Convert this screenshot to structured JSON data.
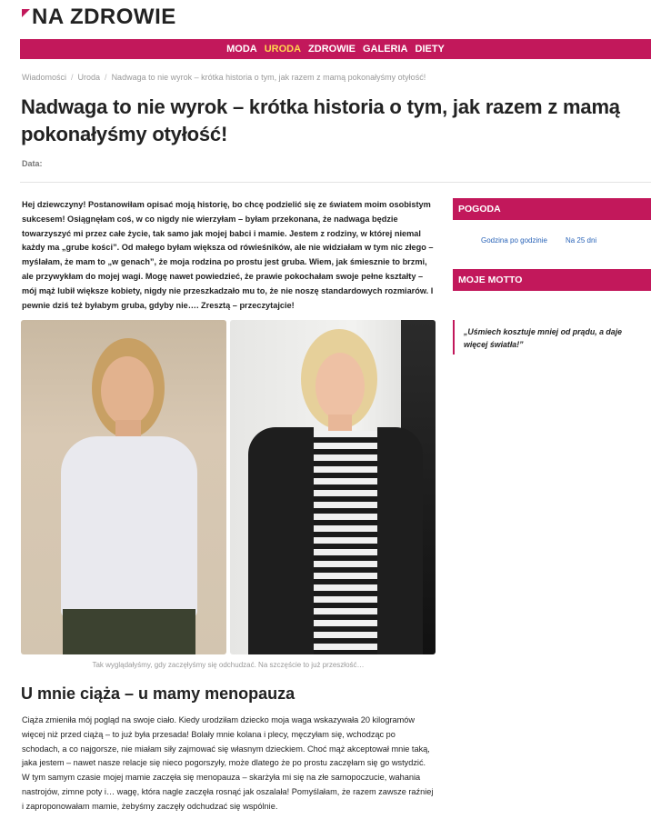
{
  "logo": {
    "text": "NA ZDROWIE"
  },
  "nav": {
    "items": [
      {
        "label": "MODA",
        "active": false
      },
      {
        "label": "URODA",
        "active": true
      },
      {
        "label": "ZDROWIE",
        "active": false
      },
      {
        "label": "GALERIA",
        "active": false
      },
      {
        "label": "DIETY",
        "active": false
      }
    ]
  },
  "breadcrumb": {
    "items": [
      "Wiadomości",
      "Uroda",
      "Nadwaga to nie wyrok – krótka historia o tym, jak razem z mamą pokonałyśmy otyłość!"
    ],
    "separator": "/"
  },
  "article": {
    "title": "Nadwaga to nie wyrok – krótka historia o tym, jak razem z mamą pokonałyśmy otyłość!",
    "date_label": "Data:",
    "intro": "Hej dziewczyny! Postanowiłam opisać moją historię, bo chcę podzielić się ze światem moim osobistym sukcesem! Osiągnęłam coś, w co nigdy nie wierzyłam – byłam przekonana, że nadwaga będzie towarzyszyć mi przez całe życie, tak samo jak mojej babci i mamie. Jestem z rodziny, w której niemal każdy ma „grube kości”. Od małego byłam większa od rówieśników, ale nie widziałam w tym nic złego – myślałam, że mam to „w genach”, że moja rodzina po prostu jest gruba. Wiem, jak śmiesznie to brzmi, ale przywykłam do mojej wagi. Mogę nawet powiedzieć, że prawie pokochałam swoje pełne kształty – mój mąż lubił większe kobiety, nigdy nie przeszkadzało mu to, że nie noszę standardowych rozmiarów. I pewnie dziś też byłabym gruba, gdyby nie…. Zresztą – przeczytajcie!",
    "photo_caption": "Tak wyglądałyśmy, gdy zaczęłyśmy się odchudzać. Na szczęście to już przeszłość…",
    "section_heading": "U mnie ciąża – u mamy menopauza",
    "paragraph1": "Ciąża zmieniła mój pogląd na swoje ciało. Kiedy urodziłam dziecko moja waga wskazywała 20 kilogramów więcej niż przed ciążą – to już była przesada! Bolały mnie kolana i plecy, męczyłam się, wchodząc po schodach, a co najgorsze, nie miałam siły zajmować się własnym dzieckiem. Choć mąż akceptował mnie taką, jaka jestem – nawet nasze relacje się nieco pogorszyły, może dlatego że po prostu zaczęłam się go wstydzić.",
    "paragraph2": "W tym samym czasie mojej mamie zaczęła się menopauza – skarżyła mi się na złe samopoczucie, wahania nastrojów, zimne poty i… wagę, która nagle zaczęła rosnąć jak oszalała! Pomyślałam, że razem zawsze raźniej i zaproponowałam mamie, żebyśmy zaczęły odchudzać się wspólnie."
  },
  "sidebar": {
    "weather": {
      "title": "POGODA",
      "links": [
        "Godzina po godzinie",
        "Na 25 dni"
      ]
    },
    "motto": {
      "title": "MOJE MOTTO",
      "quote": "„Uśmiech kosztuje mniej od prądu, a daje więcej światła!”"
    }
  },
  "colors": {
    "accent": "#c2185b",
    "nav_active": "#ffd54f",
    "link": "#2a64b8"
  }
}
